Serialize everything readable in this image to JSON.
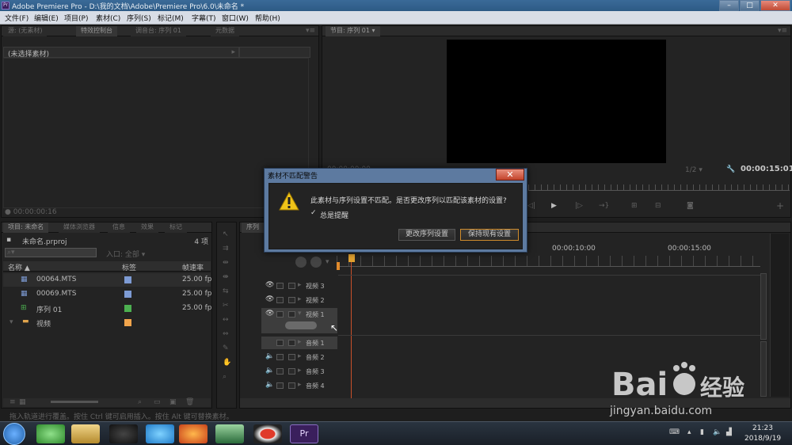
{
  "window": {
    "title": "Adobe Premiere Pro - D:\\我的文档\\Adobe\\Premiere Pro\\6.0\\未命名 *",
    "app_icon": "Pr",
    "min": "–",
    "max": "□",
    "close": "✕"
  },
  "menu": [
    "文件(F)",
    "编辑(E)",
    "项目(P)",
    "素材(C)",
    "序列(S)",
    "标记(M)",
    "字幕(T)",
    "窗口(W)",
    "帮助(H)"
  ],
  "source_panel": {
    "tabs": [
      "源: (无素材)",
      "特效控制台",
      "调音台: 序列 01",
      "元数据"
    ],
    "no_clip": "(未选择素材)",
    "timecode": "00:00:00:16"
  },
  "program_panel": {
    "tab": "节目: 序列 01",
    "timecode_left": "00:00:00:00",
    "timecode_right": "00:00:15:01",
    "zoom": "1/2"
  },
  "project_panel": {
    "tabs": [
      "项目: 未命名",
      "媒体浏览器",
      "信息",
      "效果",
      "标记"
    ],
    "project_name": "未命名.prproj",
    "item_count": "4 项",
    "entry_label": "入口: 全部",
    "columns": [
      "名称",
      "标签",
      "帧速率"
    ],
    "items": [
      {
        "name": "00064.MTS",
        "fps": "25.00 fp",
        "color": "#7d9bd4"
      },
      {
        "name": "00069.MTS",
        "fps": "25.00 fp",
        "color": "#7d9bd4"
      },
      {
        "name": "序列 01",
        "fps": "25.00 fp",
        "color": "#4caf50"
      },
      {
        "name": "视频",
        "fps": "",
        "color": "#f0a44c"
      }
    ]
  },
  "timeline": {
    "tab": "序列",
    "ruler": [
      "00:00:10:00",
      "00:00:15:00"
    ],
    "tracks": [
      "视频 3",
      "视频 2",
      "视频 1",
      "音频 1",
      "音频 2",
      "音频 3",
      "音频 4"
    ]
  },
  "dialog": {
    "title": "素材不匹配警告",
    "message": "此素材与序列设置不匹配。是否更改序列以匹配该素材的设置?",
    "checkbox_label": "总是提醒",
    "checkbox_checked": true,
    "btn_change": "更改序列设置",
    "btn_keep": "保持现有设置",
    "close": "✕"
  },
  "status_bar": "拖入轨道进行覆盖。按住 Ctrl 键可启用插入。按住 Alt 键可替换素材。",
  "taskbar": {
    "time": "21:23",
    "date": "2018/9/19"
  },
  "watermark": {
    "brand": "Bai du 经验",
    "url": "jingyan.baidu.com"
  }
}
